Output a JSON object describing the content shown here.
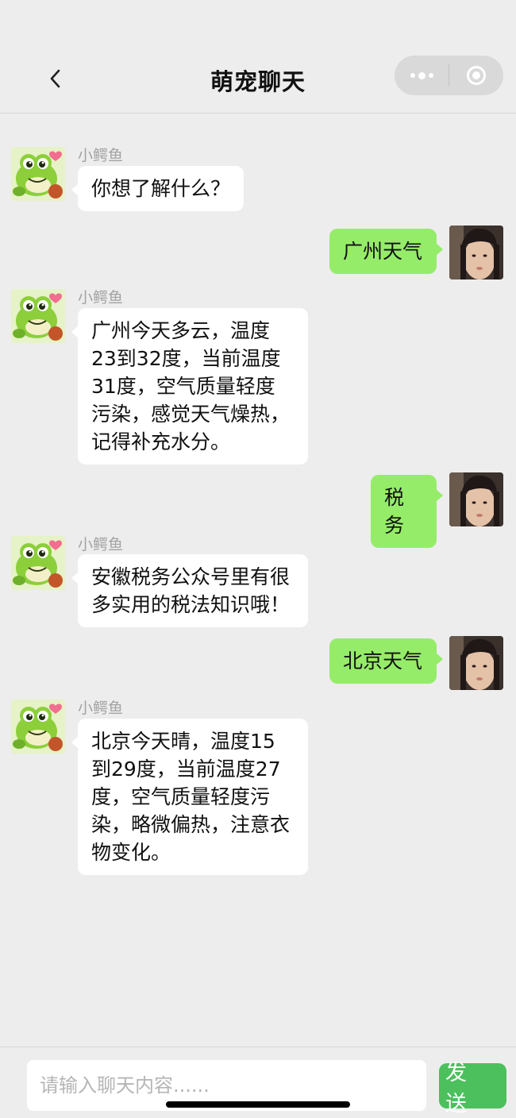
{
  "header": {
    "title": "萌宠聊天"
  },
  "bot": {
    "name": "小鳄鱼"
  },
  "messages": [
    {
      "side": "left",
      "text": "你想了解什么？"
    },
    {
      "side": "right",
      "text": "广州天气"
    },
    {
      "side": "left",
      "text": "广州今天多云，温度23到32度，当前温度31度，空气质量轻度污染，感觉天气燥热，记得补充水分。"
    },
    {
      "side": "right",
      "text": "税务"
    },
    {
      "side": "left",
      "text": "安徽税务公众号里有很多实用的税法知识哦！"
    },
    {
      "side": "right",
      "text": "北京天气"
    },
    {
      "side": "left",
      "text": "北京今天晴，温度15到29度，当前温度27度，空气质量轻度污染，略微偏热，注意衣物变化。"
    }
  ],
  "input": {
    "placeholder": "请输入聊天内容......"
  },
  "send_label": "发 送",
  "colors": {
    "user_bubble": "#95ec69",
    "send_button": "#4cc05c"
  }
}
